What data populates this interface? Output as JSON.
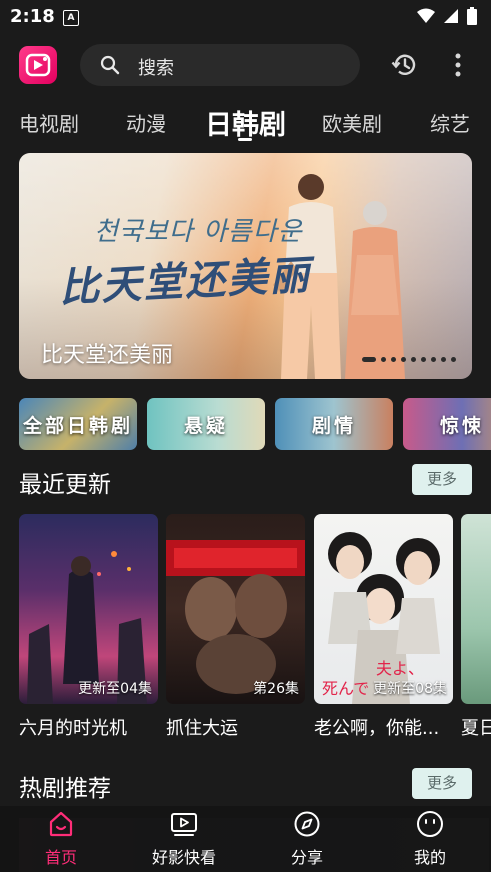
{
  "status_bar": {
    "time": "2:18",
    "notification_letter": "A"
  },
  "search": {
    "placeholder": "搜索"
  },
  "icons": {
    "logo": "video-app-logo",
    "search": "search-icon",
    "history": "history-icon",
    "more": "more-vert-icon"
  },
  "tabs": [
    {
      "label": "电视剧",
      "active": false
    },
    {
      "label": "动漫",
      "active": false
    },
    {
      "label": "日韩剧",
      "active": true
    },
    {
      "label": "欧美剧",
      "active": false
    },
    {
      "label": "综艺",
      "active": false
    }
  ],
  "banner": {
    "title": "比天堂还美丽",
    "art_korean": "천국보다 아름다운",
    "art_chinese": "比天堂还美丽",
    "slide_count": 9,
    "active_slide": 1
  },
  "genres": [
    {
      "label": "全部日韩剧"
    },
    {
      "label": "悬疑"
    },
    {
      "label": "剧情"
    },
    {
      "label": "惊悚"
    }
  ],
  "recent": {
    "title": "最近更新",
    "more_label": "更多",
    "items": [
      {
        "name": "六月的时光机",
        "episode": "更新至04集"
      },
      {
        "name": "抓住大运",
        "episode": "第26集"
      },
      {
        "name": "老公啊，你能...",
        "episode": "更新至08集"
      },
      {
        "name": "夏日",
        "episode": ""
      }
    ]
  },
  "hot": {
    "title": "热剧推荐",
    "more_label": "更多"
  },
  "bottom_nav": [
    {
      "label": "首页",
      "icon": "home-icon",
      "active": true
    },
    {
      "label": "好影快看",
      "icon": "video-play-icon",
      "active": false
    },
    {
      "label": "分享",
      "icon": "compass-icon",
      "active": false
    },
    {
      "label": "我的",
      "icon": "profile-icon",
      "active": false
    }
  ],
  "colors": {
    "accent": "#ff2d78",
    "background": "#1b1b1b",
    "more_pill": "#dff1ee"
  }
}
